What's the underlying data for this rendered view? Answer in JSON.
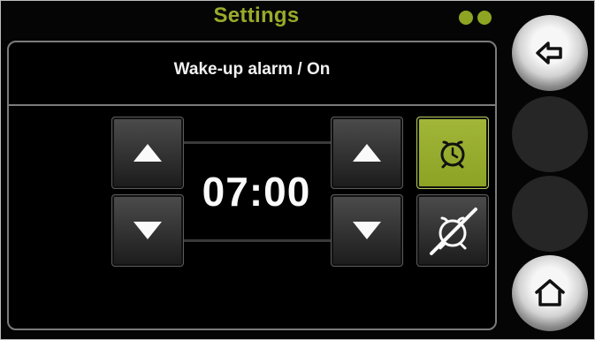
{
  "header": {
    "title": "Settings"
  },
  "panel": {
    "header": "Wake-up alarm / On",
    "time": "07:00"
  },
  "controls": {
    "hour_up_icon": "arrow-up-icon",
    "hour_down_icon": "arrow-down-icon",
    "minute_up_icon": "arrow-up-icon",
    "minute_down_icon": "arrow-down-icon",
    "alarm_on_icon": "alarm-clock-icon",
    "alarm_off_icon": "alarm-off-icon"
  },
  "sidebar": {
    "back_icon": "back-arrow-icon",
    "home_icon": "home-icon"
  },
  "colors": {
    "accent": "#9aab2a",
    "background": "#000000",
    "button": "#2f2f2f",
    "text": "#ffffff"
  }
}
